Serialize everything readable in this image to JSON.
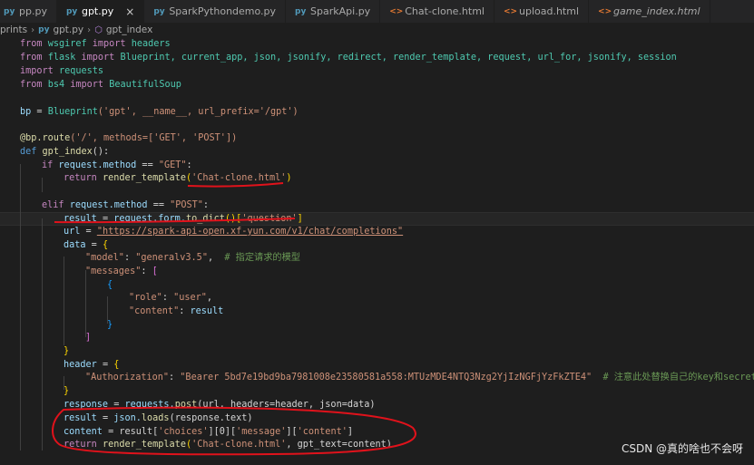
{
  "tabs": [
    {
      "label": "pp.py",
      "icon": "python-file-icon",
      "active": false
    },
    {
      "label": "gpt.py",
      "icon": "python-file-icon",
      "active": true
    },
    {
      "label": "SparkPythondemo.py",
      "icon": "python-file-icon",
      "active": false
    },
    {
      "label": "SparkApi.py",
      "icon": "python-file-icon",
      "active": false
    },
    {
      "label": "Chat-clone.html",
      "icon": "html-file-icon",
      "active": false
    },
    {
      "label": "upload.html",
      "icon": "html-file-icon",
      "active": false
    },
    {
      "label": "game_index.html",
      "icon": "html-file-icon",
      "active": false
    }
  ],
  "breadcrumb": {
    "folder": "prints",
    "file": "gpt.py",
    "symbol": "gpt_index"
  },
  "code": {
    "line1": {
      "kw": "from",
      "mod": "wsgiref",
      "kw2": "import",
      "name": "headers"
    },
    "line2": {
      "kw": "from",
      "mod": "flask",
      "kw2": "import",
      "names": "Blueprint, current_app, json, jsonify, redirect, render_template, request, url_for, jsonify, session"
    },
    "line3": {
      "kw": "import",
      "mod": "requests"
    },
    "line4": {
      "kw": "from",
      "mod": "bs4",
      "kw2": "import",
      "name": "BeautifulSoup"
    },
    "bp_line": {
      "var": "bp",
      "eq": " = ",
      "fn": "Blueprint",
      "args": "('gpt', __name__, url_prefix='/gpt')"
    },
    "decorator": {
      "at": "@bp.route",
      "args": "('/', methods=['GET', 'POST'])"
    },
    "def_line": {
      "kw": "def",
      "fn": "gpt_index",
      "rest": "():"
    },
    "if_line": {
      "kw": "if",
      "cond": "request.method",
      "op": " == ",
      "str": "\"GET\"",
      "end": ":"
    },
    "return1": {
      "kw": "return",
      "fn": "render_template",
      "open": "(",
      "str": "'Chat-clone.html'",
      "close": ")"
    },
    "elif_line": {
      "kw": "elif",
      "cond": "request.method",
      "op": " == ",
      "str": "\"POST\"",
      "end": ":"
    },
    "result_line": {
      "var": "result",
      "eq": " = ",
      "obj": "request.form.",
      "fn": "to_dict",
      "call": "()",
      "open": "[",
      "str": "'question'",
      "close": "]"
    },
    "url_line": {
      "var": "url",
      "eq": " = ",
      "str": "\"https://spark-api-open.xf-yun.com/v1/chat/completions\""
    },
    "data_line": {
      "var": "data",
      "eq": " = ",
      "brace": "{"
    },
    "model_line": {
      "key": "\"model\"",
      "colon": ": ",
      "val": "\"generalv3.5\"",
      "comma": ",  ",
      "cmt": "# 指定请求的模型"
    },
    "messages_line": {
      "key": "\"messages\"",
      "colon": ": ",
      "bracket": "["
    },
    "open_brace": "{",
    "role_line": {
      "key": "\"role\"",
      "colon": ": ",
      "val": "\"user\"",
      "comma": ","
    },
    "content_line": {
      "key": "\"content\"",
      "colon": ": ",
      "val": "result"
    },
    "close_brace": "}",
    "close_bracket": "]",
    "close_data": "}",
    "header_line": {
      "var": "header",
      "eq": " = ",
      "brace": "{"
    },
    "auth_line": {
      "key": "\"Authorization\"",
      "colon": ": ",
      "val": "\"Bearer 5bd7e19bd9ba7981008e23580581a558:MTUzMDE4NTQ3Nzg2YjIzNGFjYzFkZTE4\"",
      "pad": "  ",
      "cmt": "# 注意此处替换自己的key和secret"
    },
    "close_header": "}",
    "response_line": {
      "var": "response",
      "eq": " = ",
      "obj": "requests.",
      "fn": "post",
      "args": "(url, headers=header, json=data)"
    },
    "result2_line": {
      "var": "result",
      "eq": " = ",
      "obj": "json.",
      "fn": "loads",
      "args": "(response.text)"
    },
    "content2_line": {
      "var": "content",
      "eq": " = ",
      "rest": "result[",
      "s1": "'choices'",
      "m1": "][0][",
      "s2": "'message'",
      "m2": "][",
      "s3": "'content'",
      "end": "]"
    },
    "return2_line": {
      "kw": "return",
      "fn": "render_template",
      "open": "(",
      "str": "'Chat-clone.html'",
      "rest": ", gpt_text=content)"
    }
  },
  "watermark": "CSDN @真的啥也不会呀",
  "colors": {
    "annotation": "#e0121b",
    "background": "#1e1e1e",
    "keyword": "#c586c0",
    "string": "#ce9178",
    "function": "#dcdcaa",
    "variable": "#9cdcfe"
  }
}
